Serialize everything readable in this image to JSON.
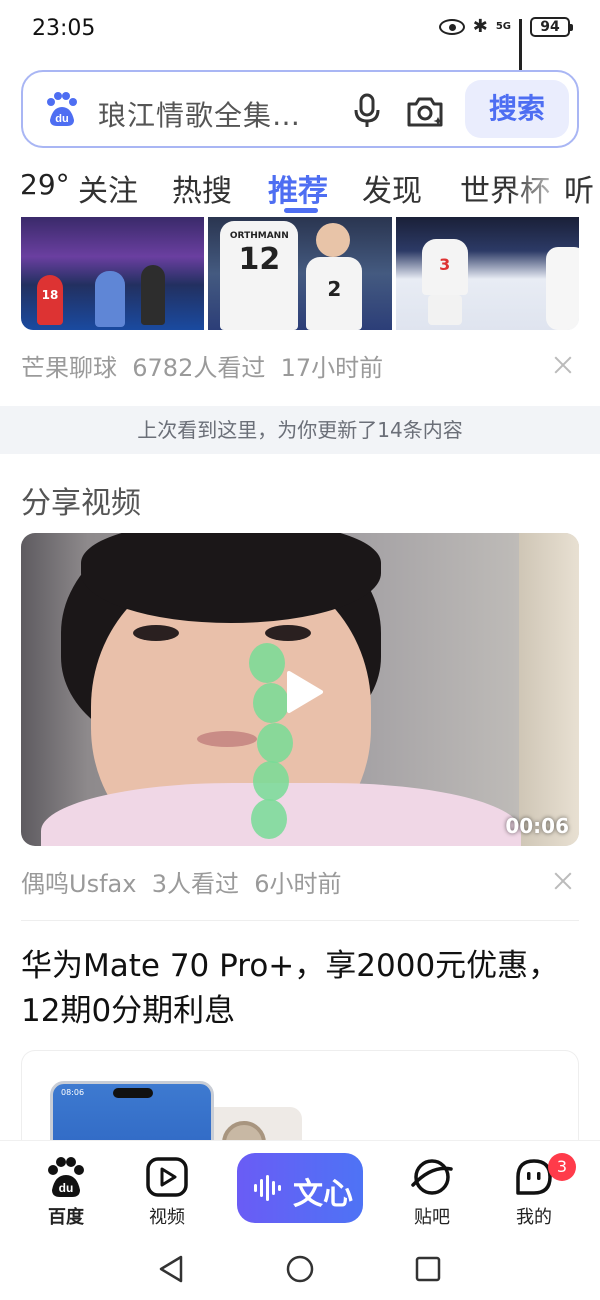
{
  "status_bar": {
    "time": "23:05",
    "network": "5G",
    "battery": "94"
  },
  "search": {
    "query": "琅江情歌全集…",
    "button_label": "搜索",
    "logo_text": "du"
  },
  "tabs": {
    "weather_temp": "29°",
    "items": [
      "关注",
      "热搜",
      "推荐",
      "发现",
      "世界杯",
      "听"
    ],
    "active": "推荐"
  },
  "card1": {
    "source": "芒果聊球",
    "views": "6782人看过",
    "time": "17小时前",
    "jersey_numbers": [
      "18",
      "12",
      "2",
      "3"
    ],
    "jersey_name": "ORTHMANN"
  },
  "refresh_banner": "上次看到这里，为你更新了14条内容",
  "section_title": "分享视频",
  "video": {
    "duration": "00:06",
    "source": "偶鸣Usfax",
    "views": "3人看过",
    "time": "6小时前"
  },
  "ad": {
    "title": "华为Mate 70 Pro+，享2000元优惠，12期0分期利息",
    "phone_time": "08:06"
  },
  "bottom_nav": {
    "items": [
      {
        "label": "百度",
        "icon": "baidu-paw-icon"
      },
      {
        "label": "视频",
        "icon": "video-play-icon"
      },
      {
        "label": "文心",
        "icon": "wenxin-icon"
      },
      {
        "label": "贴吧",
        "icon": "tieba-icon"
      },
      {
        "label": "我的",
        "icon": "profile-face-icon"
      }
    ],
    "badge_count": "3"
  },
  "colors": {
    "accent": "#4e6ef2",
    "badge": "#ff3b4a",
    "meta_text": "#9a9a9a"
  }
}
